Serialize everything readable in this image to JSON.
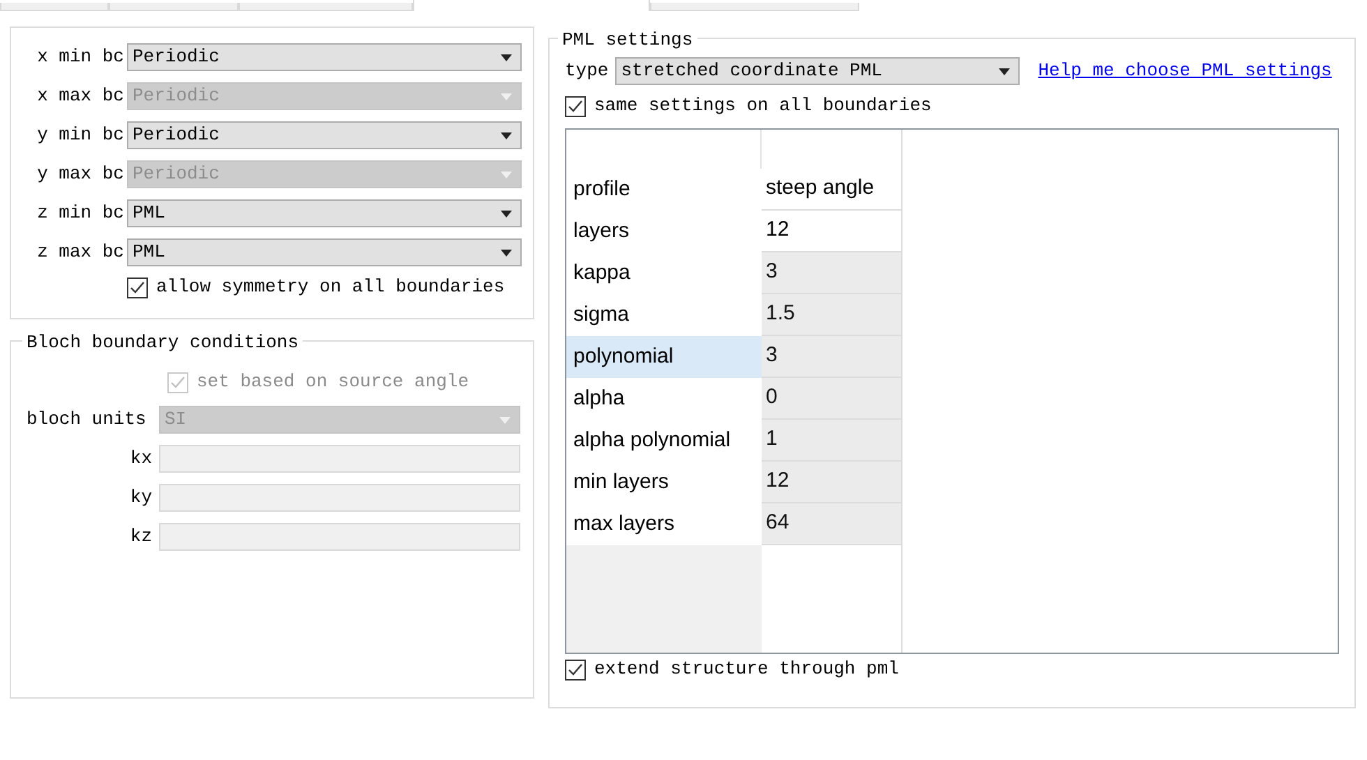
{
  "tabs": [
    {
      "selected": false
    },
    {
      "selected": false
    },
    {
      "selected": false
    },
    {
      "selected": true
    },
    {
      "selected": false
    }
  ],
  "boundaries": {
    "rows": [
      {
        "label": "x min bc",
        "value": "Periodic",
        "disabled": false
      },
      {
        "label": "x max bc",
        "value": "Periodic",
        "disabled": true
      },
      {
        "label": "y min bc",
        "value": "Periodic",
        "disabled": false
      },
      {
        "label": "y max bc",
        "value": "Periodic",
        "disabled": true
      },
      {
        "label": "z min bc",
        "value": "PML",
        "disabled": false
      },
      {
        "label": "z max bc",
        "value": "PML",
        "disabled": false
      }
    ],
    "symmetry": {
      "label": "allow symmetry on all boundaries",
      "checked": true,
      "disabled": false
    }
  },
  "bloch": {
    "title": "Bloch boundary conditions",
    "source_angle": {
      "label": "set based on source angle",
      "checked": true,
      "disabled": true
    },
    "units": {
      "label": "bloch units",
      "value": "SI",
      "disabled": true
    },
    "fields": [
      {
        "label": "kx"
      },
      {
        "label": "ky"
      },
      {
        "label": "kz"
      }
    ]
  },
  "pml": {
    "title": "PML settings",
    "type_label": "type",
    "type_value": "stretched coordinate PML",
    "help_link": "Help me choose PML settings",
    "same_settings": {
      "label": "same settings on all boundaries",
      "checked": true,
      "disabled": false
    },
    "table": [
      {
        "name": "profile",
        "value": "steep angle",
        "selected": false,
        "disabled": false
      },
      {
        "name": "layers",
        "value": "12",
        "selected": false,
        "disabled": false
      },
      {
        "name": "kappa",
        "value": "3",
        "selected": false,
        "disabled": true
      },
      {
        "name": "sigma",
        "value": "1.5",
        "selected": false,
        "disabled": true
      },
      {
        "name": "polynomial",
        "value": "3",
        "selected": true,
        "disabled": true
      },
      {
        "name": "alpha",
        "value": "0",
        "selected": false,
        "disabled": true
      },
      {
        "name": "alpha polynomial",
        "value": "1",
        "selected": false,
        "disabled": true
      },
      {
        "name": "min layers",
        "value": "12",
        "selected": false,
        "disabled": true
      },
      {
        "name": "max layers",
        "value": "64",
        "selected": false,
        "disabled": true
      }
    ],
    "extend": {
      "label": "extend structure through pml",
      "checked": true,
      "disabled": false
    }
  }
}
